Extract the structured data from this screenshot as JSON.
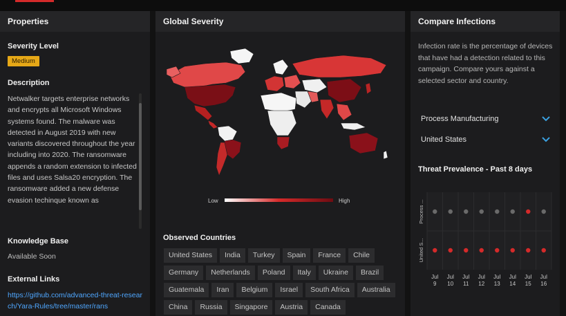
{
  "properties": {
    "title": "Properties",
    "severity_label": "Severity Level",
    "severity_value": "Medium",
    "description_label": "Description",
    "description_text": "Netwalker targets enterprise networks and encrypts all Microsoft Windows systems found. The malware was detected in August 2019 with new variants discovered throughout the year including into 2020. The ransomware appends a random extension to infected files and uses Salsa20 encryption. The ransomware added a new defense evasion techinque known as",
    "kb_label": "Knowledge Base",
    "kb_value": "Available Soon",
    "links_label": "External Links",
    "links_value": "https://github.com/advanced-threat-research/Yara-Rules/tree/master/rans"
  },
  "severity": {
    "title": "Global Severity",
    "legend_low": "Low",
    "legend_high": "High",
    "observed_title": "Observed Countries",
    "countries": [
      "United States",
      "India",
      "Turkey",
      "Spain",
      "France",
      "Chile",
      "Germany",
      "Netherlands",
      "Poland",
      "Italy",
      "Ukraine",
      "Brazil",
      "Guatemala",
      "Iran",
      "Belgium",
      "Israel",
      "South Africa",
      "Australia",
      "China",
      "Russia",
      "Singapore",
      "Austria",
      "Canada"
    ],
    "colors": {
      "low": "#ffffff",
      "mid": "#d62a2a",
      "high": "#6e0c12"
    }
  },
  "compare": {
    "title": "Compare Infections",
    "description": "Infection rate is the percentage of devices that have had a detection related to this campaign. Compare yours against a selected sector and country.",
    "sector": "Process Manufacturing",
    "country": "United States",
    "chevron_icon": "chevron-down-icon",
    "accent": "#3aa0e0"
  },
  "chart_data": {
    "type": "scatter",
    "title": "Threat Prevalence - Past 8 days",
    "row_labels": [
      "Process ...",
      "United S..."
    ],
    "categories": [
      "Jul 9",
      "Jul 10",
      "Jul 11",
      "Jul 12",
      "Jul 13",
      "Jul 14",
      "Jul 15",
      "Jul 16"
    ],
    "series": [
      {
        "name": "Process ...",
        "detected": [
          false,
          false,
          false,
          false,
          false,
          false,
          true,
          false
        ]
      },
      {
        "name": "United S...",
        "detected": [
          true,
          true,
          true,
          true,
          true,
          true,
          true,
          true
        ]
      }
    ],
    "colors": {
      "detected": "#d42a2a",
      "none": "#6a6a6a"
    }
  }
}
